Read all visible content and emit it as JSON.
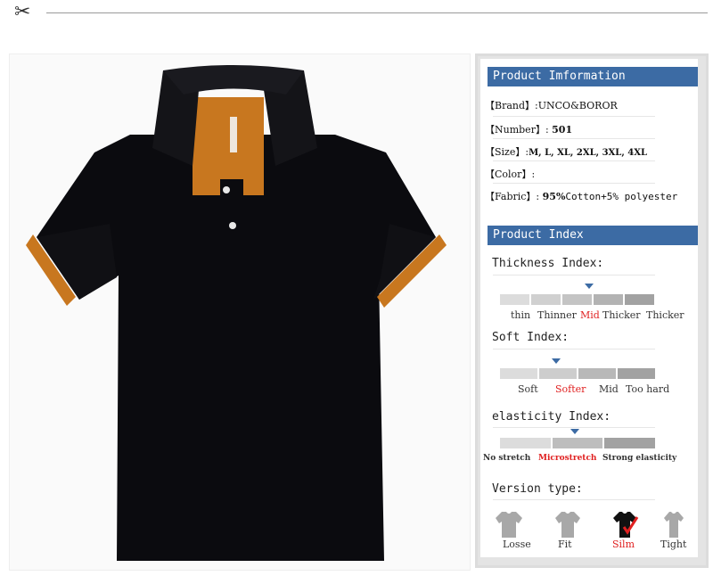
{
  "product_info": {
    "header": "Product Imformation",
    "brand_label": "【Brand】:",
    "brand_value": "UNCO&BOROR",
    "number_label": "【Number】:",
    "number_value": "501",
    "size_label": "【Size】:",
    "size_value": "M, L, XL, 2XL, 3XL, 4XL",
    "color_label": "【Color】:",
    "fabric_label": "【Fabric】:",
    "fabric_value_bold": "95%",
    "fabric_value": "Cotton+5% polyester"
  },
  "product_index": {
    "header": "Product Index",
    "thickness": {
      "title": "Thickness Index:",
      "options": [
        "thin",
        "Thinner",
        "Mid",
        "Thicker",
        "Thicker"
      ],
      "selected": 2
    },
    "soft": {
      "title": "Soft Index:",
      "options": [
        "Soft",
        "Softer",
        "Mid",
        "Too hard"
      ],
      "selected": 1
    },
    "elasticity": {
      "title": "elasticity Index:",
      "options": [
        "No stretch",
        "Microstretch",
        "Strong elasticity"
      ],
      "selected": 1
    },
    "version": {
      "title": "Version type:",
      "options": [
        "Losse",
        "Fit",
        "Silm",
        "Tight"
      ],
      "selected": 2
    }
  },
  "colors": {
    "accent_bar": "#3c6ba4",
    "highlight": "#e02020",
    "shirt_body": "#0b0b0f",
    "shirt_trim": "#c8771f"
  },
  "icons": {
    "scissors": "scissors-icon",
    "check": "check-icon"
  }
}
